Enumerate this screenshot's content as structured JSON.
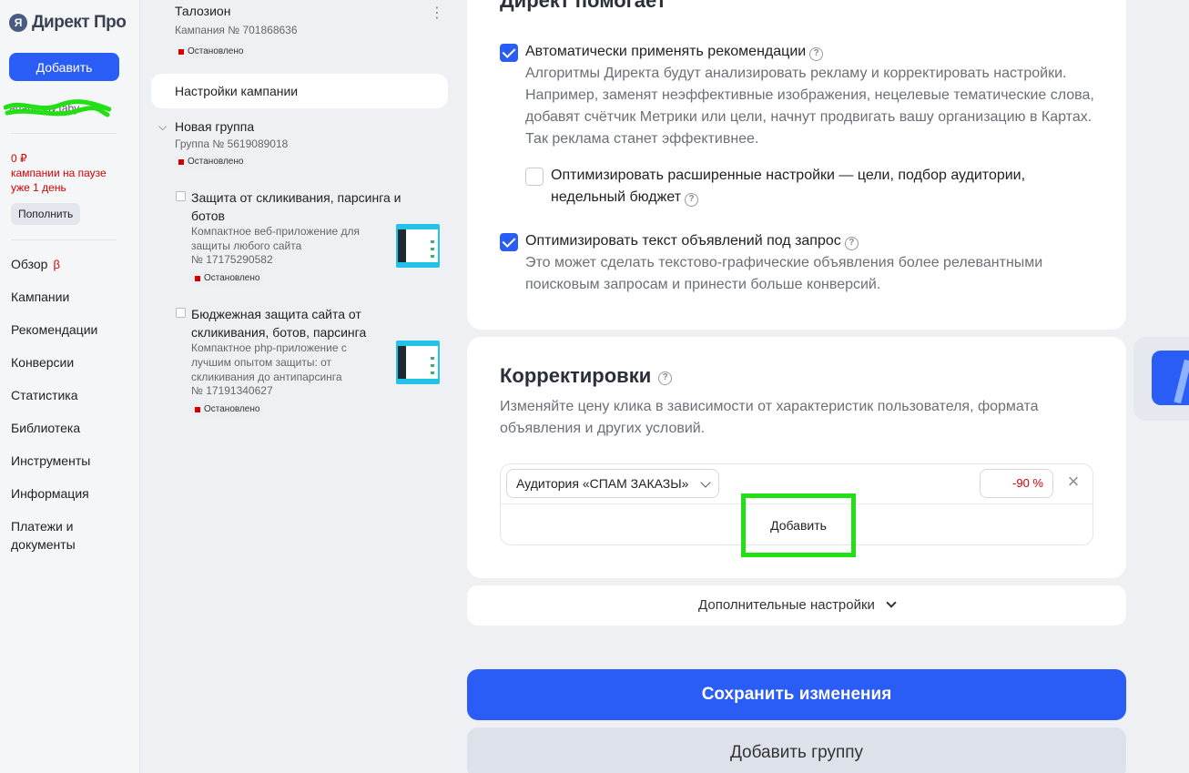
{
  "sidebar": {
    "logo": "Директ Про",
    "add_button": "Добавить",
    "user": "ananasov.taby",
    "balance": "0 ₽",
    "paused_note": "кампании на паузе уже 1 день",
    "topup_button": "Пополнить",
    "nav": [
      "Обзор",
      "Кампании",
      "Рекомендации",
      "Конверсии",
      "Статистика",
      "Библиотека",
      "Инструменты",
      "Информация",
      "Платежи и документы"
    ],
    "beta": "β"
  },
  "tree": {
    "campaign_name": "Талозион",
    "campaign_number": "Кампания № 701868636",
    "status": "Остановлено",
    "settings_link": "Настройки кампании",
    "group_name": "Новая группа",
    "group_number": "Группа № 5619089018",
    "ads": [
      {
        "title": "Защита от скликивания, парсинга и ботов",
        "desc": "Компактное веб-приложение для защиты любого сайта",
        "number": "№ 17175290582",
        "status": "Остановлено"
      },
      {
        "title": "Бюджежная защита сайта от скликивания, ботов, парсинга",
        "desc": "Компактное php-приложение с лучшим опытом защиты: от скликивания до антипарсинга",
        "number": "№ 17191340627",
        "status": "Остановлено"
      }
    ]
  },
  "main": {
    "helps_title": "Директ помогает",
    "opt1_label": "Автоматически применять рекомендации",
    "opt1_desc": "Алгоритмы Директа будут анализировать рекламу и корректировать настройки. Например, заменят неэффективные изображения, нецелевые тематические слова, добавят счётчик Метрики или цели, начнут продвигать вашу организацию в Картах. Так реклама станет эффективнее.",
    "opt1a_label": "Оптимизировать расширенные настройки — цели, подбор аудитории, недельный бюджет",
    "opt2_label": "Оптимизировать текст объявлений под запрос",
    "opt2_desc": "Это может сделать текстово-графические объявления более релевантными поисковым запросам и принести больше конверсий.",
    "adj_title": "Корректировки",
    "adj_desc": "Изменяйте цену клика в зависимости от характеристик пользователя, формата объявления и других условий.",
    "audience": "Аудитория «СПАМ ЗАКАЗЫ»",
    "percent": "-90 %",
    "adj_add": "Добавить",
    "more_settings": "Дополнительные настройки",
    "save": "Сохранить изменения",
    "add_group": "Добавить группу"
  },
  "colors": {
    "accent": "#2a5cf6",
    "stopped": "#d40000",
    "highlight": "#22e015"
  }
}
